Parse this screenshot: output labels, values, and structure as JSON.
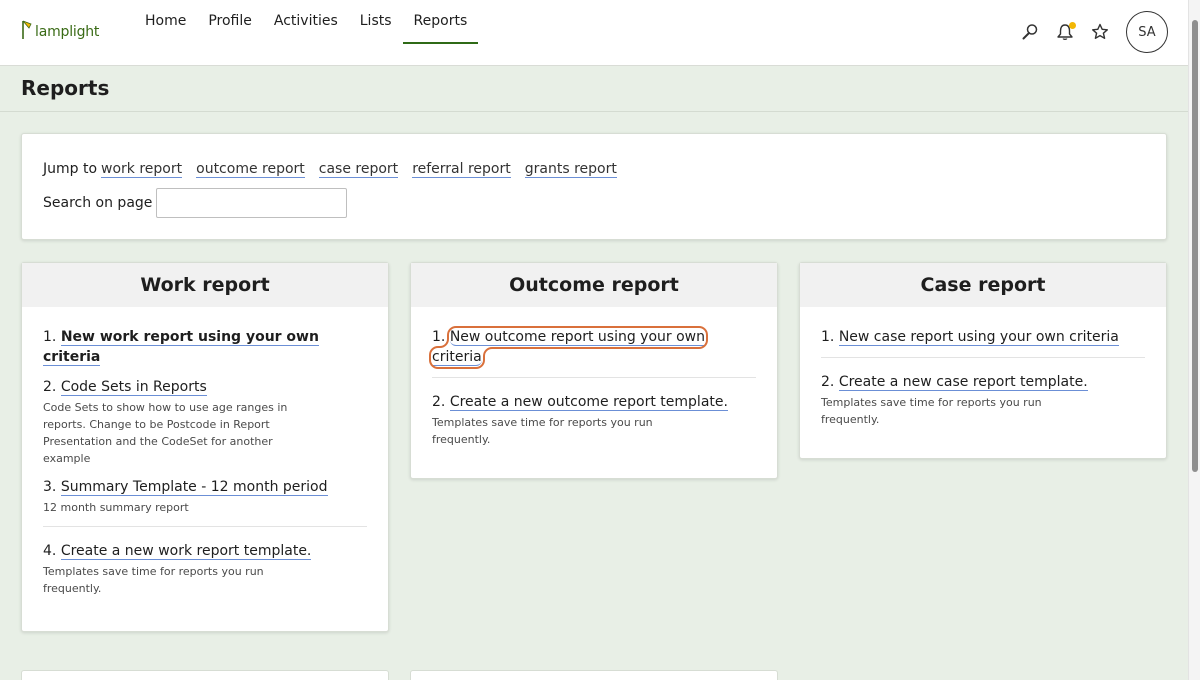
{
  "app": {
    "logo_text": "lamplight"
  },
  "nav": {
    "items": [
      {
        "label": "Home"
      },
      {
        "label": "Profile"
      },
      {
        "label": "Activities"
      },
      {
        "label": "Lists"
      },
      {
        "label": "Reports"
      }
    ],
    "active": "Reports"
  },
  "user": {
    "initials": "SA"
  },
  "colors": {
    "brand_green": "#2f6a16",
    "link_underline": "#6b8fd6",
    "highlight": "#d9703b",
    "notification_dot": "#f2b705",
    "page_bg": "#e8efe6"
  },
  "page": {
    "title": "Reports"
  },
  "jump": {
    "label": "Jump to",
    "links": [
      "work report",
      "outcome report",
      "case report",
      "referral report",
      "grants report"
    ],
    "search_label": "Search on page",
    "search_value": ""
  },
  "cards": {
    "work": {
      "title": "Work report",
      "items": [
        {
          "num": "1.",
          "label": "New work report using your own criteria",
          "desc": ""
        },
        {
          "num": "2.",
          "label": "Code Sets in Reports",
          "desc": "Code Sets to show how to use age ranges in reports. Change to be Postcode in Report Presentation and the CodeSet for another example"
        },
        {
          "num": "3.",
          "label": "Summary Template - 12 month period",
          "desc": "12 month summary report"
        },
        {
          "num": "4.",
          "label": "Create a new work report template.",
          "desc": "Templates save time for reports you run frequently."
        }
      ]
    },
    "outcome": {
      "title": "Outcome report",
      "items": [
        {
          "num": "1.",
          "label": "New outcome report using your own criteria",
          "desc": ""
        },
        {
          "num": "2.",
          "label": "Create a new outcome report template.",
          "desc": "Templates save time for reports you run frequently."
        }
      ]
    },
    "case": {
      "title": "Case report",
      "items": [
        {
          "num": "1.",
          "label": "New case report using your own criteria",
          "desc": ""
        },
        {
          "num": "2.",
          "label": "Create a new case report template.",
          "desc": "Templates save time for reports you run frequently."
        }
      ]
    }
  },
  "icons": [
    "lamp-logo-icon",
    "search-icon",
    "bell-icon",
    "star-icon"
  ]
}
